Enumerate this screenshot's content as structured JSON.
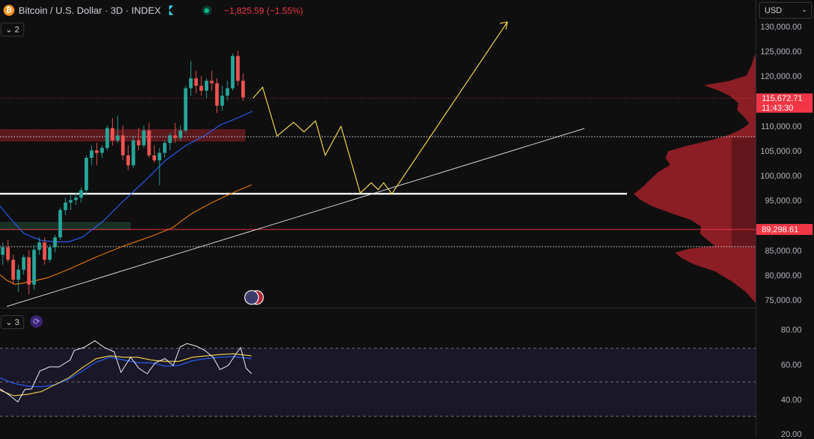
{
  "header": {
    "logo_letter": "₿",
    "symbol_title": "Bitcoin / U.S. Dollar · 3D · INDEX",
    "change_text": "−1,825.59 (−1.55%)",
    "market_status_icon": "market-open-dot-icon"
  },
  "currency": {
    "label": "USD",
    "chevron": "⌄"
  },
  "main_pane": {
    "collapse_label": "⌄ 2"
  },
  "rsi_pane": {
    "collapse_label": "⌄ 3",
    "icon": "refresh-icon"
  },
  "price_axis": {
    "labels": [
      "130,000.00",
      "125,000.00",
      "120,000.00",
      "110,000.00",
      "105,000.00",
      "100,000.00",
      "95,000.00",
      "85,000.00",
      "80,000.00",
      "75,000.00"
    ],
    "current_price": "115,672.71",
    "countdown": "11:43:30",
    "marked_level": "89,298.61"
  },
  "rsi_axis": {
    "labels": [
      "80.00",
      "60.00",
      "40.00",
      "20.00"
    ]
  },
  "colors": {
    "up": "#26a69a",
    "down": "#ef5350",
    "projection": "#f0d34a",
    "ma_fast": "#2962ff",
    "ma_slow": "#f57c00",
    "profile": "#8b1e24"
  },
  "event_icon": "us-flag-events-icon",
  "chart_data": {
    "type": "candlestick",
    "symbol": "Bitcoin / U.S. Dollar · 3D · INDEX",
    "last_price": 115672.71,
    "price_ylim": [
      75000,
      130000
    ],
    "candles": [
      [
        84000,
        86500,
        82000,
        85500
      ],
      [
        85500,
        87000,
        82500,
        83000
      ],
      [
        83000,
        84000,
        78000,
        79000
      ],
      [
        79000,
        82000,
        76500,
        81000
      ],
      [
        81000,
        84000,
        80000,
        83500
      ],
      [
        83500,
        85000,
        76000,
        78000
      ],
      [
        78000,
        86000,
        77000,
        85000
      ],
      [
        85000,
        87500,
        84000,
        86500
      ],
      [
        86500,
        87500,
        82000,
        83000
      ],
      [
        83000,
        86000,
        82500,
        85500
      ],
      [
        85500,
        88000,
        84500,
        87500
      ],
      [
        87500,
        93500,
        87000,
        93000
      ],
      [
        93000,
        95500,
        92000,
        94500
      ],
      [
        94500,
        96000,
        93000,
        95000
      ],
      [
        95000,
        96500,
        94000,
        95500
      ],
      [
        95500,
        97500,
        94500,
        97000
      ],
      [
        97000,
        104000,
        96000,
        103500
      ],
      [
        103500,
        106000,
        102000,
        105000
      ],
      [
        105000,
        106500,
        102000,
        104500
      ],
      [
        104500,
        106000,
        103500,
        105500
      ],
      [
        105500,
        110000,
        105000,
        109500
      ],
      [
        109500,
        111500,
        106000,
        107000
      ],
      [
        107000,
        112000,
        106500,
        108000
      ],
      [
        108000,
        110000,
        103000,
        104000
      ],
      [
        104000,
        106000,
        101000,
        102000
      ],
      [
        102000,
        108000,
        101500,
        107000
      ],
      [
        107000,
        109500,
        105000,
        106000
      ],
      [
        106000,
        110000,
        105500,
        109000
      ],
      [
        109000,
        110500,
        103500,
        104000
      ],
      [
        104000,
        106000,
        102500,
        103000
      ],
      [
        103000,
        105500,
        98000,
        104500
      ],
      [
        104500,
        107000,
        103500,
        106500
      ],
      [
        106500,
        108500,
        105000,
        108000
      ],
      [
        108000,
        110500,
        106500,
        107500
      ],
      [
        107500,
        110000,
        107000,
        109000
      ],
      [
        109000,
        118000,
        108500,
        117500
      ],
      [
        117500,
        123000,
        116000,
        119500
      ],
      [
        119500,
        121000,
        116500,
        118000
      ],
      [
        118000,
        120000,
        116000,
        117000
      ],
      [
        117000,
        119500,
        115500,
        119000
      ],
      [
        119000,
        121000,
        117000,
        118500
      ],
      [
        118500,
        119500,
        112500,
        114000
      ],
      [
        114000,
        118000,
        113000,
        116000
      ],
      [
        116000,
        119000,
        115000,
        117500
      ],
      [
        117500,
        124500,
        117000,
        124000
      ],
      [
        124000,
        125000,
        118000,
        119000
      ],
      [
        119000,
        120500,
        115000,
        115672.71
      ]
    ],
    "rsi": {
      "ylim": [
        20,
        85
      ],
      "upper_band": 70,
      "mid_band": 50,
      "lower_band": 30
    }
  }
}
